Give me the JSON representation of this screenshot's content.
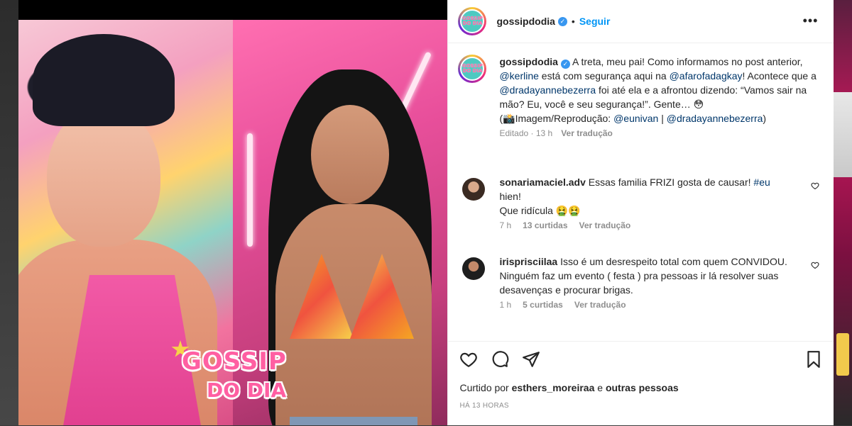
{
  "colors": {
    "accent": "#0095f6",
    "mention": "#00376b",
    "muted": "#8e8e8e",
    "text": "#262626",
    "verified": "#3897f0"
  },
  "media": {
    "brand_line1": "GOSSIP",
    "brand_line2": "DO DIA"
  },
  "header": {
    "avatar_text_1": "GOSSIP",
    "avatar_text_2": "DO DIA",
    "username": "gossipdodia",
    "verified_icon": "verified-badge-icon",
    "dot": "•",
    "follow_label": "Seguir",
    "more_label": "•••"
  },
  "caption": {
    "username": "gossipdodia",
    "t1": " A treta, meu pai! Como informamos no post anterior, ",
    "m1": "@kerline",
    "t2": " está com segurança aqui na ",
    "m2": "@afarofadagkay",
    "t3": "! Acontece que a ",
    "m3": "@dradayannebezerra",
    "t4": " foi até ela e a afrontou dizendo: “Vamos sair na mão? Eu, você e seu segurança!”. Gente… 😳",
    "t5": "(📸Imagem/Reprodução: ",
    "m4": "@eunivan",
    "t6": " | ",
    "m5": "@dradayannebezerra",
    "t7": ")",
    "edited": "Editado · 13 h",
    "translate": "Ver tradução"
  },
  "comments": [
    {
      "username": "sonariamaciel.adv",
      "text_before": " Essas familia FRIZI gosta de causar! ",
      "hashtag": "#eu",
      "text_after": " hien!",
      "line2": "Que ridícula 🤮🤮",
      "time": "7 h",
      "likes": "13 curtidas",
      "translate": "Ver tradução"
    },
    {
      "username": "irisprisciilaa",
      "text": " Isso é um desrespeito total com quem CONVIDOU. Ninguém faz um evento ( festa ) pra pessoas ir lá resolver suas desavenças e procurar brigas.",
      "time": "1 h",
      "likes": "5 curtidas",
      "translate": "Ver tradução"
    }
  ],
  "actions": {
    "liked_prefix": "Curtido por ",
    "liked_user": "esthers_moreiraa",
    "liked_mid": " e ",
    "liked_others": "outras pessoas",
    "timestamp": "HÁ 13 HORAS"
  }
}
